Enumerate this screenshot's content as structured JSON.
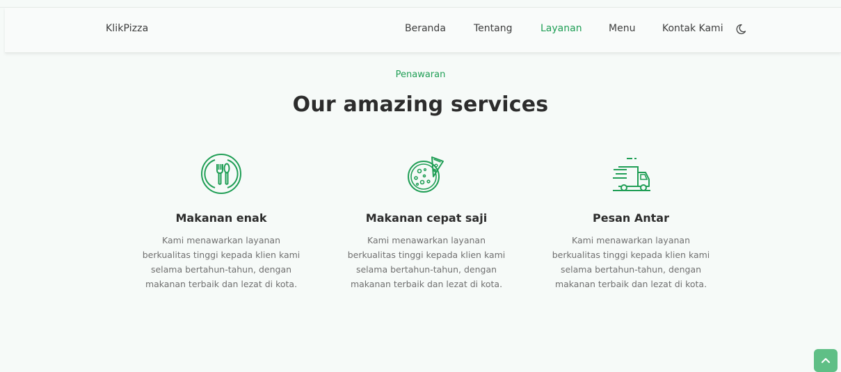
{
  "header": {
    "brand": "KlikPizza",
    "nav": [
      {
        "label": "Beranda",
        "active": false
      },
      {
        "label": "Tentang",
        "active": false
      },
      {
        "label": "Layanan",
        "active": true
      },
      {
        "label": "Menu",
        "active": false
      },
      {
        "label": "Kontak Kami",
        "active": false
      }
    ],
    "theme_toggle_icon": "moon-icon"
  },
  "services": {
    "eyebrow": "Penawaran",
    "title": "Our amazing services",
    "items": [
      {
        "icon": "dining-icon",
        "title": "Makanan enak",
        "desc": "Kami menawarkan layanan berkualitas tinggi kepada klien kami selama bertahun-tahun, dengan makanan terbaik dan lezat di kota."
      },
      {
        "icon": "pizza-icon",
        "title": "Makanan cepat saji",
        "desc": "Kami menawarkan layanan berkualitas tinggi kepada klien kami selama bertahun-tahun, dengan makanan terbaik dan lezat di kota."
      },
      {
        "icon": "delivery-truck-icon",
        "title": "Pesan Antar",
        "desc": "Kami menawarkan layanan berkualitas tinggi kepada klien kami selama bertahun-tahun, dengan makanan terbaik dan lezat di kota."
      }
    ]
  },
  "scroll_top_icon": "chevron-up-icon",
  "colors": {
    "accent": "#1f9e55",
    "scroll_button": "#5fbf86",
    "background": "#f6faf8"
  }
}
